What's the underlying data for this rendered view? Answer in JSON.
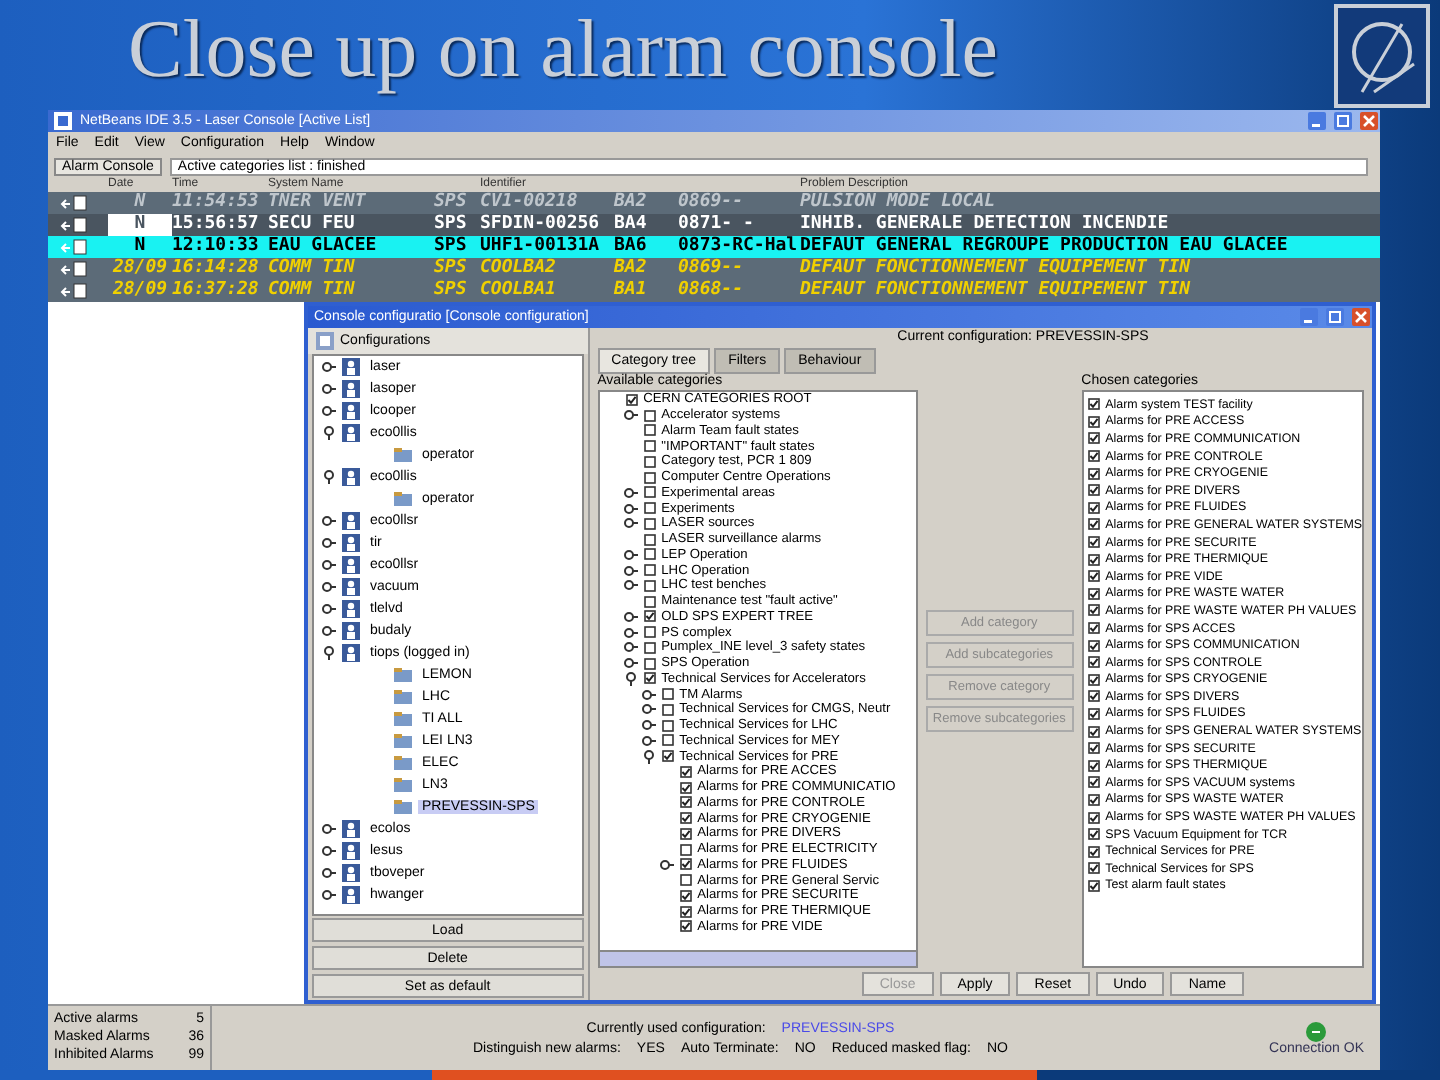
{
  "slide": {
    "title": "Close up on alarm console"
  },
  "window": {
    "title": "NetBeans IDE 3.5 - Laser Console [Active List]"
  },
  "menu": [
    "File",
    "Edit",
    "View",
    "Configuration",
    "Help",
    "Window"
  ],
  "toolbar": {
    "tab": "Alarm Console",
    "status": "Active categories list : finished"
  },
  "table": {
    "columns": [
      "Date",
      "Time",
      "System Name",
      "Identifier",
      "Problem Description"
    ],
    "rows": [
      {
        "kind": "terminated",
        "selected": false,
        "date": "N",
        "time": "11:54:53",
        "system": "TNER VENT",
        "site": "SPS",
        "identifier": "CV1-00218",
        "building": "BA2",
        "location": "0869--",
        "description": "PULSION MODE LOCAL"
      },
      {
        "kind": "active",
        "selected": false,
        "date": "N",
        "time": "15:56:57",
        "system": "SECU FEU",
        "site": "SPS",
        "identifier": "SFDIN-00256",
        "building": "BA4",
        "location": "0871- -",
        "description": "INHIB. GENERALE DETECTION INCENDIE"
      },
      {
        "kind": "active",
        "selected": true,
        "date": "N",
        "time": "12:10:33",
        "system": "EAU  GLACEE",
        "site": "SPS",
        "identifier": "UHF1-00131A",
        "building": "BA6",
        "location": "0873-RC-Hal",
        "description": "DEFAUT GENERAL REGROUPE PRODUCTION EAU GLACEE"
      },
      {
        "kind": "new",
        "selected": false,
        "date": "28/09",
        "time": "16:14:28",
        "system": "COMM TIN",
        "site": "SPS",
        "identifier": "COOLBA2",
        "building": "BA2",
        "location": "0869--",
        "description": "DEFAUT FONCTIONNEMENT EQUIPEMENT TIN"
      },
      {
        "kind": "new",
        "selected": false,
        "date": "28/09",
        "time": "16:37:28",
        "system": "COMM TIN",
        "site": "SPS",
        "identifier": "COOLBA1",
        "building": "BA1",
        "location": "0868--",
        "description": "DEFAUT FONCTIONNEMENT EQUIPEMENT TIN"
      }
    ]
  },
  "dialog": {
    "title": "Console configuratio [Console configuration]",
    "configurations": {
      "header": "Configurations",
      "tree": [
        {
          "label": "laser",
          "kind": "user",
          "expanded": false,
          "selected": false
        },
        {
          "label": "lasoper",
          "kind": "user",
          "expanded": false,
          "selected": false
        },
        {
          "label": "lcooper",
          "kind": "user",
          "expanded": false,
          "selected": false
        },
        {
          "label": "eco0llis",
          "kind": "user",
          "expanded": true,
          "selected": false,
          "children": [
            {
              "label": "operator",
              "kind": "config",
              "selected": false
            }
          ]
        },
        {
          "label": "eco0llis",
          "kind": "user",
          "expanded": true,
          "selected": false,
          "children": [
            {
              "label": "operator",
              "kind": "config",
              "selected": false
            }
          ]
        },
        {
          "label": "eco0llsr",
          "kind": "user",
          "expanded": false,
          "selected": false
        },
        {
          "label": "tir",
          "kind": "user",
          "expanded": false,
          "selected": false
        },
        {
          "label": "eco0llsr",
          "kind": "user",
          "expanded": false,
          "selected": false
        },
        {
          "label": "vacuum",
          "kind": "user",
          "expanded": false,
          "selected": false
        },
        {
          "label": "tlelvd",
          "kind": "user",
          "expanded": false,
          "selected": false
        },
        {
          "label": "budaly",
          "kind": "user",
          "expanded": false,
          "selected": false
        },
        {
          "label": "tiops (logged in)",
          "kind": "user",
          "expanded": true,
          "selected": false,
          "children": [
            {
              "label": "LEMON",
              "kind": "config",
              "selected": false
            },
            {
              "label": "LHC",
              "kind": "config",
              "selected": false
            },
            {
              "label": "TI ALL",
              "kind": "config",
              "selected": false
            },
            {
              "label": "LEI LN3",
              "kind": "config",
              "selected": false
            },
            {
              "label": "ELEC",
              "kind": "config",
              "selected": false
            },
            {
              "label": "LN3",
              "kind": "config",
              "selected": false
            },
            {
              "label": "PREVESSIN-SPS",
              "kind": "config",
              "selected": true
            }
          ]
        },
        {
          "label": "ecolos",
          "kind": "user",
          "expanded": false,
          "selected": false
        },
        {
          "label": "lesus",
          "kind": "user",
          "expanded": false,
          "selected": false
        },
        {
          "label": "tboveper",
          "kind": "user",
          "expanded": false,
          "selected": false
        },
        {
          "label": "hwanger",
          "kind": "user",
          "expanded": false,
          "selected": false
        }
      ],
      "buttons": [
        "Load",
        "Delete",
        "Set as default"
      ]
    },
    "current": "Current configuration: PREVESSIN-SPS",
    "tabs": [
      {
        "label": "Category tree",
        "selected": true
      },
      {
        "label": "Filters",
        "selected": false
      },
      {
        "label": "Behaviour",
        "selected": false
      }
    ],
    "available_label": "Available categories",
    "available": [
      {
        "label": "CERN CATEGORIES ROOT",
        "checked": true,
        "children": [
          {
            "label": "Accelerator systems",
            "checked": false,
            "expanded": false
          },
          {
            "label": "Alarm Team fault states",
            "checked": false
          },
          {
            "label": "\"IMPORTANT\" fault states",
            "checked": false
          },
          {
            "label": "Category test, PCR 1 809",
            "checked": false
          },
          {
            "label": "Computer Centre Operations",
            "checked": false
          },
          {
            "label": "Experimental areas",
            "checked": false,
            "expanded": false
          },
          {
            "label": "Experiments",
            "checked": false,
            "expanded": false
          },
          {
            "label": "LASER sources",
            "checked": false,
            "expanded": false
          },
          {
            "label": "LASER surveillance alarms",
            "checked": false
          },
          {
            "label": "LEP Operation",
            "checked": false,
            "expanded": false
          },
          {
            "label": "LHC Operation",
            "checked": false,
            "expanded": false
          },
          {
            "label": "LHC test benches",
            "checked": false,
            "expanded": false
          },
          {
            "label": "Maintenance test \"fault active\"",
            "checked": false
          },
          {
            "label": "OLD SPS EXPERT TREE",
            "checked": true,
            "expanded": false
          },
          {
            "label": "PS complex",
            "checked": false,
            "expanded": false
          },
          {
            "label": "Pumplex_INE level_3 safety states",
            "checked": false,
            "expanded": false
          },
          {
            "label": "SPS Operation",
            "checked": false,
            "expanded": false
          },
          {
            "label": "Technical Services for Accelerators",
            "checked": true,
            "expanded": true,
            "children": [
              {
                "label": "TM Alarms",
                "checked": false,
                "expanded": false
              },
              {
                "label": "Technical Services for CMGS, Neutr",
                "checked": false,
                "expanded": false
              },
              {
                "label": "Technical Services for LHC",
                "checked": false,
                "expanded": false
              },
              {
                "label": "Technical Services for MEY",
                "checked": false,
                "expanded": false
              },
              {
                "label": "Technical Services for PRE",
                "checked": true,
                "expanded": true,
                "children": [
                  {
                    "label": "Alarms for PRE ACCES",
                    "checked": true
                  },
                  {
                    "label": "Alarms for PRE COMMUNICATIO",
                    "checked": true
                  },
                  {
                    "label": "Alarms for PRE CONTROLE",
                    "checked": true
                  },
                  {
                    "label": "Alarms for PRE CRYOGENIE",
                    "checked": true
                  },
                  {
                    "label": "Alarms for PRE DIVERS",
                    "checked": true
                  },
                  {
                    "label": "Alarms for PRE ELECTRICITY",
                    "checked": false
                  },
                  {
                    "label": "Alarms for PRE FLUIDES",
                    "checked": true,
                    "expanded": false
                  },
                  {
                    "label": "Alarms for PRE General Servic",
                    "checked": false
                  },
                  {
                    "label": "Alarms for PRE SECURITE",
                    "checked": true
                  },
                  {
                    "label": "Alarms for PRE THERMIQUE",
                    "checked": true
                  },
                  {
                    "label": "Alarms for PRE VIDE",
                    "checked": true
                  }
                ]
              }
            ]
          }
        ]
      }
    ],
    "middle_buttons": [
      "Add category",
      "Add subcategories",
      "Remove category",
      "Remove subcategories"
    ],
    "chosen_label": "Chosen categories",
    "chosen": [
      {
        "label": "Alarm system TEST facility",
        "checked": true
      },
      {
        "label": "Alarms for PRE ACCESS",
        "checked": true
      },
      {
        "label": "Alarms for PRE COMMUNICATION",
        "checked": true
      },
      {
        "label": "Alarms for PRE CONTROLE",
        "checked": true
      },
      {
        "label": "Alarms for PRE CRYOGENIE",
        "checked": true
      },
      {
        "label": "Alarms for PRE DIVERS",
        "checked": true
      },
      {
        "label": "Alarms for PRE FLUIDES",
        "checked": true
      },
      {
        "label": "Alarms for PRE GENERAL WATER SYSTEMS",
        "checked": true
      },
      {
        "label": "Alarms for PRE SECURITE",
        "checked": true
      },
      {
        "label": "Alarms for PRE THERMIQUE",
        "checked": true
      },
      {
        "label": "Alarms for PRE VIDE",
        "checked": true
      },
      {
        "label": "Alarms for PRE WASTE WATER",
        "checked": true
      },
      {
        "label": "Alarms for PRE WASTE WATER PH VALUES",
        "checked": true
      },
      {
        "label": "Alarms for SPS ACCES",
        "checked": true
      },
      {
        "label": "Alarms for SPS COMMUNICATION",
        "checked": true
      },
      {
        "label": "Alarms for SPS CONTROLE",
        "checked": true
      },
      {
        "label": "Alarms for SPS CRYOGENIE",
        "checked": true
      },
      {
        "label": "Alarms for SPS DIVERS",
        "checked": true
      },
      {
        "label": "Alarms for SPS FLUIDES",
        "checked": true
      },
      {
        "label": "Alarms for SPS GENERAL WATER SYSTEMS",
        "checked": true
      },
      {
        "label": "Alarms for SPS SECURITE",
        "checked": true
      },
      {
        "label": "Alarms for SPS THERMIQUE",
        "checked": true
      },
      {
        "label": "Alarms for SPS VACUUM systems",
        "checked": true
      },
      {
        "label": "Alarms for SPS WASTE WATER",
        "checked": true
      },
      {
        "label": "Alarms for SPS WASTE WATER PH VALUES",
        "checked": true
      },
      {
        "label": "SPS Vacuum Equipment for TCR",
        "checked": true
      },
      {
        "label": "Technical Services for PRE",
        "checked": true
      },
      {
        "label": "Technical Services for SPS",
        "checked": true
      },
      {
        "label": "Test alarm fault states",
        "checked": true
      }
    ],
    "buttons": [
      {
        "label": "Close",
        "disabled": true
      },
      {
        "label": "Apply",
        "disabled": false
      },
      {
        "label": "Reset",
        "disabled": false
      },
      {
        "label": "Undo",
        "disabled": false
      },
      {
        "label": "Name",
        "disabled": false
      }
    ]
  },
  "status_bar": {
    "counts": [
      {
        "label": "Active alarms",
        "value": "5"
      },
      {
        "label": "Masked Alarms",
        "value": "36"
      },
      {
        "label": "Inhibited Alarms",
        "value": "99"
      }
    ],
    "configuration_label": "Currently used configuration:",
    "configuration": "PREVESSIN-SPS",
    "flags": [
      {
        "label": "Distinguish new alarms:",
        "value": "YES"
      },
      {
        "label": "Auto Terminate:",
        "value": "NO"
      },
      {
        "label": "Reduced masked flag:",
        "value": "NO"
      }
    ],
    "connection": "Connection OK"
  }
}
